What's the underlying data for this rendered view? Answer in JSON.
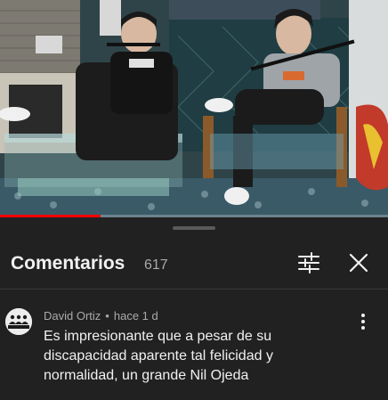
{
  "video": {
    "progress_fraction": 0.26,
    "progress_color": "#ff0000"
  },
  "comments_panel": {
    "title": "Comentarios",
    "count": "617",
    "filter_icon": "sliders-icon",
    "close_icon": "close-icon"
  },
  "comment": {
    "author": "David Ortiz",
    "separator": "•",
    "time": "hace 1 d",
    "text": "Es impresionante que a pesar de su discapacidad aparente tal felicidad y normalidad, un grande Nil Ojeda",
    "menu_icon": "more-vert-icon"
  },
  "colors": {
    "background": "#0f0f0f",
    "sheet": "#212121",
    "primary_text": "#f1f1f1",
    "secondary_text": "#aaaaaa"
  }
}
